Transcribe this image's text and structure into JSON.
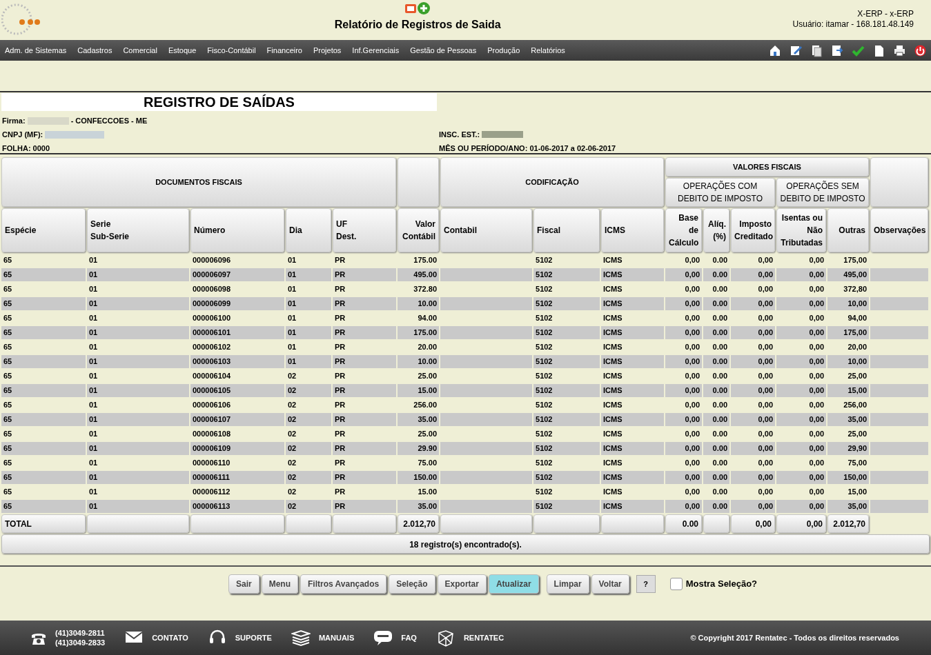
{
  "header": {
    "title": "Relatório de Registros de Saida",
    "system": "X-ERP - x-ERP",
    "user": "Usuário: itamar - 168.181.48.149"
  },
  "menu": [
    "Adm. de Sistemas",
    "Cadastros",
    "Comercial",
    "Estoque",
    "Fisco-Contábil",
    "Financeiro",
    "Projetos",
    "Inf.Gerenciais",
    "Gestão de Pessoas",
    "Produção",
    "Relatórios"
  ],
  "report": {
    "title": "REGISTRO DE SAÍDAS",
    "firma_label": "Firma:",
    "firma_value": "- CONFECCOES - ME",
    "cnpj_label": "CNPJ (MF):",
    "insc_label": "INSC. EST.:",
    "folha": "FOLHA: 0000",
    "periodo": "MÊS OU PERÍODO/ANO: 01-06-2017 a 02-06-2017"
  },
  "table": {
    "groups": {
      "documentos": "DOCUMENTOS FISCAIS",
      "codificacao": "CODIFICAÇÃO",
      "valores": "VALORES FISCAIS",
      "com_debito": "OPERAÇÕES COM\nDEBITO DE IMPOSTO",
      "sem_debito": "OPERAÇÕES SEM\nDEBITO DE IMPOSTO"
    },
    "columns": [
      "Espécie",
      "Serie\nSub-Serie",
      "Número",
      "Dia",
      "UF\nDest.",
      "Valor\nContábil",
      "Contabil",
      "Fiscal",
      "ICMS",
      "Base\nde\nCálculo",
      "Alíq.\n(%)",
      "Imposto\nCreditado",
      "Isentas ou\nNão\nTributadas",
      "Outras",
      "Observações"
    ],
    "rows": [
      [
        "65",
        "01",
        "000006096",
        "01",
        "PR",
        "175.00",
        "",
        "5102",
        "ICMS",
        "0,00",
        "0.00",
        "0,00",
        "0,00",
        "175,00",
        ""
      ],
      [
        "65",
        "01",
        "000006097",
        "01",
        "PR",
        "495.00",
        "",
        "5102",
        "ICMS",
        "0,00",
        "0.00",
        "0,00",
        "0,00",
        "495,00",
        ""
      ],
      [
        "65",
        "01",
        "000006098",
        "01",
        "PR",
        "372.80",
        "",
        "5102",
        "ICMS",
        "0,00",
        "0.00",
        "0,00",
        "0,00",
        "372,80",
        ""
      ],
      [
        "65",
        "01",
        "000006099",
        "01",
        "PR",
        "10.00",
        "",
        "5102",
        "ICMS",
        "0,00",
        "0.00",
        "0,00",
        "0,00",
        "10,00",
        ""
      ],
      [
        "65",
        "01",
        "000006100",
        "01",
        "PR",
        "94.00",
        "",
        "5102",
        "ICMS",
        "0,00",
        "0.00",
        "0,00",
        "0,00",
        "94,00",
        ""
      ],
      [
        "65",
        "01",
        "000006101",
        "01",
        "PR",
        "175.00",
        "",
        "5102",
        "ICMS",
        "0,00",
        "0.00",
        "0,00",
        "0,00",
        "175,00",
        ""
      ],
      [
        "65",
        "01",
        "000006102",
        "01",
        "PR",
        "20.00",
        "",
        "5102",
        "ICMS",
        "0,00",
        "0.00",
        "0,00",
        "0,00",
        "20,00",
        ""
      ],
      [
        "65",
        "01",
        "000006103",
        "01",
        "PR",
        "10.00",
        "",
        "5102",
        "ICMS",
        "0,00",
        "0.00",
        "0,00",
        "0,00",
        "10,00",
        ""
      ],
      [
        "65",
        "01",
        "000006104",
        "02",
        "PR",
        "25.00",
        "",
        "5102",
        "ICMS",
        "0,00",
        "0.00",
        "0,00",
        "0,00",
        "25,00",
        ""
      ],
      [
        "65",
        "01",
        "000006105",
        "02",
        "PR",
        "15.00",
        "",
        "5102",
        "ICMS",
        "0,00",
        "0.00",
        "0,00",
        "0,00",
        "15,00",
        ""
      ],
      [
        "65",
        "01",
        "000006106",
        "02",
        "PR",
        "256.00",
        "",
        "5102",
        "ICMS",
        "0,00",
        "0.00",
        "0,00",
        "0,00",
        "256,00",
        ""
      ],
      [
        "65",
        "01",
        "000006107",
        "02",
        "PR",
        "35.00",
        "",
        "5102",
        "ICMS",
        "0,00",
        "0.00",
        "0,00",
        "0,00",
        "35,00",
        ""
      ],
      [
        "65",
        "01",
        "000006108",
        "02",
        "PR",
        "25.00",
        "",
        "5102",
        "ICMS",
        "0,00",
        "0.00",
        "0,00",
        "0,00",
        "25,00",
        ""
      ],
      [
        "65",
        "01",
        "000006109",
        "02",
        "PR",
        "29.90",
        "",
        "5102",
        "ICMS",
        "0,00",
        "0.00",
        "0,00",
        "0,00",
        "29,90",
        ""
      ],
      [
        "65",
        "01",
        "000006110",
        "02",
        "PR",
        "75.00",
        "",
        "5102",
        "ICMS",
        "0,00",
        "0.00",
        "0,00",
        "0,00",
        "75,00",
        ""
      ],
      [
        "65",
        "01",
        "000006111",
        "02",
        "PR",
        "150.00",
        "",
        "5102",
        "ICMS",
        "0,00",
        "0.00",
        "0,00",
        "0,00",
        "150,00",
        ""
      ],
      [
        "65",
        "01",
        "000006112",
        "02",
        "PR",
        "15.00",
        "",
        "5102",
        "ICMS",
        "0,00",
        "0.00",
        "0,00",
        "0,00",
        "15,00",
        ""
      ],
      [
        "65",
        "01",
        "000006113",
        "02",
        "PR",
        "35.00",
        "",
        "5102",
        "ICMS",
        "0,00",
        "0.00",
        "0,00",
        "0,00",
        "35,00",
        ""
      ]
    ],
    "total": {
      "label": "TOTAL",
      "valor": "2.012,70",
      "base": "0.00",
      "imposto": "0,00",
      "isentas": "0,00",
      "outras": "2.012,70"
    },
    "count": "18 registro(s) encontrado(s)."
  },
  "buttons": [
    {
      "label": "Sair",
      "selected": false
    },
    {
      "label": "Menu",
      "selected": false
    },
    {
      "label": "Filtros Avançados",
      "selected": false
    },
    {
      "label": "Seleção",
      "selected": false
    },
    {
      "label": "Exportar",
      "selected": false
    },
    {
      "label": "Atualizar",
      "selected": true
    },
    {
      "label": "Limpar",
      "selected": false
    },
    {
      "label": "Voltar",
      "selected": false
    }
  ],
  "help": "?",
  "show_selection": {
    "label": "Mostra Seleção?",
    "checked": false
  },
  "footer": {
    "phones": [
      "(41)3049-2811",
      "(41)3049-2833"
    ],
    "links": [
      {
        "kind": "mail",
        "label": "CONTATO"
      },
      {
        "kind": "headset",
        "label": "SUPORTE"
      },
      {
        "kind": "books",
        "label": "MANUAIS"
      },
      {
        "kind": "faq",
        "label": "FAQ"
      },
      {
        "kind": "network",
        "label": "RENTATEC"
      }
    ],
    "copyright": "© Copyright 2017 Rentatec - Todos os direitos reservados"
  }
}
